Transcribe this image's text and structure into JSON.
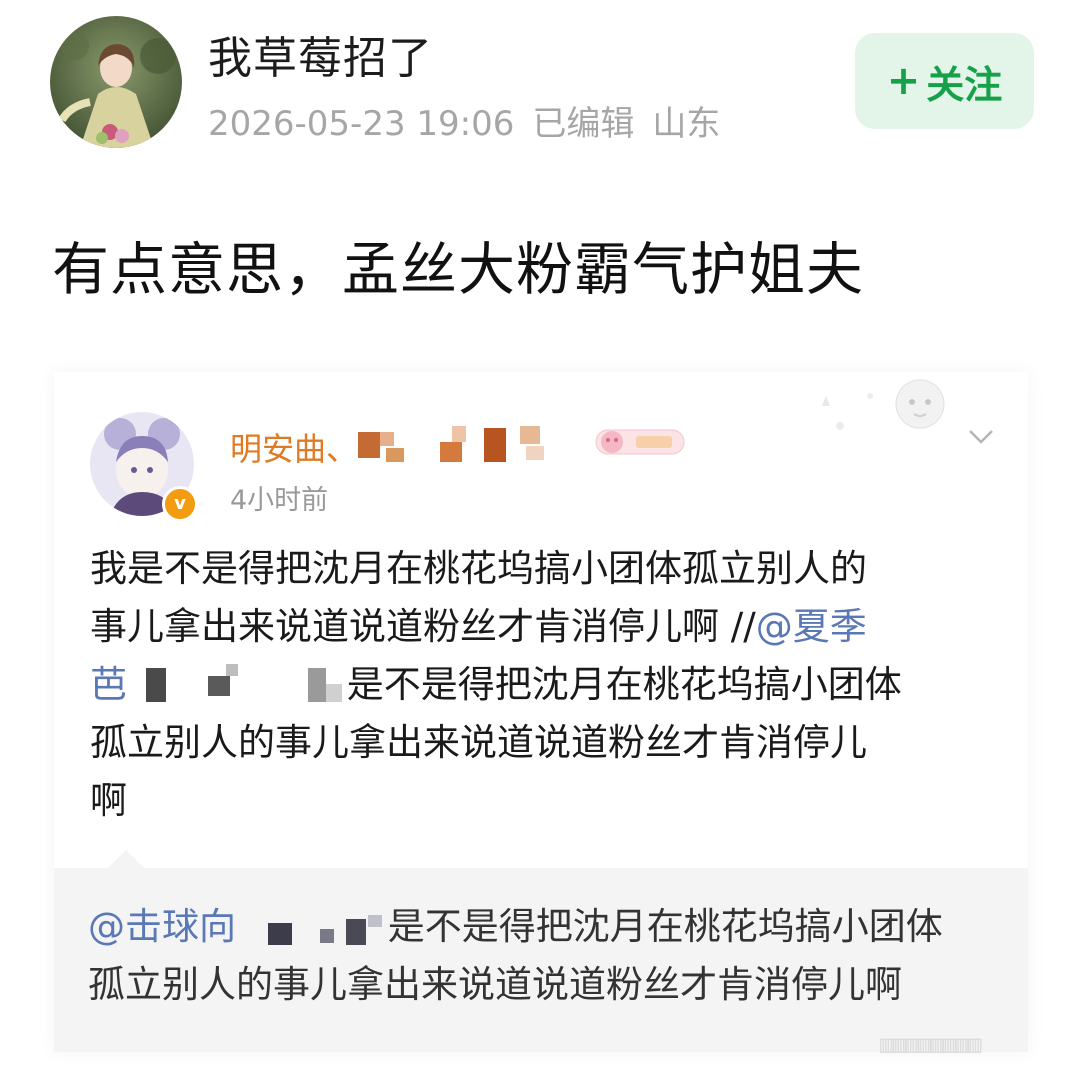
{
  "post": {
    "username": "我草莓招了",
    "timestamp": "2026-05-23 19:06",
    "edited_label": "已编辑",
    "location": "山东",
    "follow_label": "关注",
    "text": "有点意思，孟丝大粉霸气护姐夫"
  },
  "embedded": {
    "name_visible": "明安曲、",
    "time": "4小时前",
    "verified_badge": "v",
    "body_lines": [
      "我是不是得把沈月在桃花坞搞小团体孤立别人的",
      "事儿拿出来说道说道粉丝才肯消停儿啊 //",
      "是不是得把沈月在桃花坞搞小团体",
      "孤立别人的事儿拿出来说道说道粉丝才肯消停儿",
      "啊"
    ],
    "mention_partial": "@夏季",
    "mention_partial_line3": "芭",
    "quoted": {
      "mention_partial": "@击球向",
      "line1_rest": "是不是得把沈月在桃花坞搞小团体",
      "line2": "孤立别人的事儿拿出来说道说道粉丝才肯消停儿啊"
    }
  },
  "colors": {
    "follow_bg": "#e3f5e8",
    "follow_text": "#17a04a",
    "inner_name": "#e07b25",
    "mention": "#5a78b5",
    "quote_bg": "#f4f4f4"
  }
}
